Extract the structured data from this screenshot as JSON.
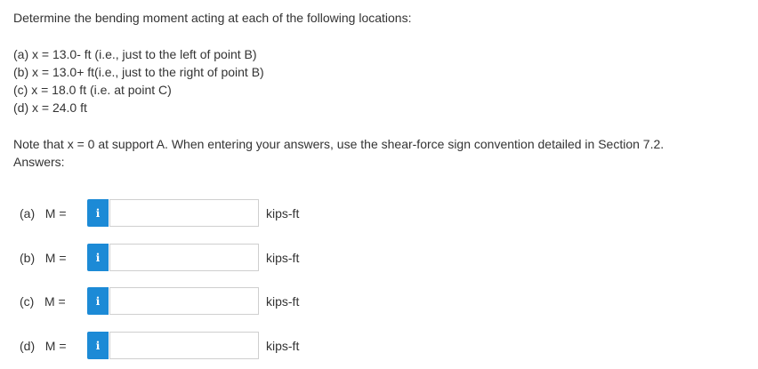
{
  "question": {
    "intro": "Determine the bending moment acting at each of the following locations:",
    "parts": [
      {
        "text": "(a) x = 13.0- ft (i.e., just to the left of point B)"
      },
      {
        "text": "(b) x = 13.0+ ft(i.e., just to the right of point B)"
      },
      {
        "text": "(c) x = 18.0 ft (i.e. at point C)"
      },
      {
        "text": "(d) x = 24.0 ft"
      }
    ],
    "note": "Note that x = 0 at support A. When entering your answers, use the shear-force sign convention detailed in Section 7.2.",
    "answers_label": "Answers:"
  },
  "answers": [
    {
      "label": "(a)   M =",
      "info": "i",
      "value": "",
      "unit": "kips-ft"
    },
    {
      "label": "(b)   M =",
      "info": "i",
      "value": "",
      "unit": "kips-ft"
    },
    {
      "label": "(c)   M =",
      "info": "i",
      "value": "",
      "unit": "kips-ft"
    },
    {
      "label": "(d)   M =",
      "info": "i",
      "value": "",
      "unit": "kips-ft"
    }
  ],
  "colors": {
    "info_button": "#1c8ad6",
    "text": "#333333",
    "input_border": "#cfcfcf"
  },
  "icons": {
    "info": "info-icon"
  }
}
